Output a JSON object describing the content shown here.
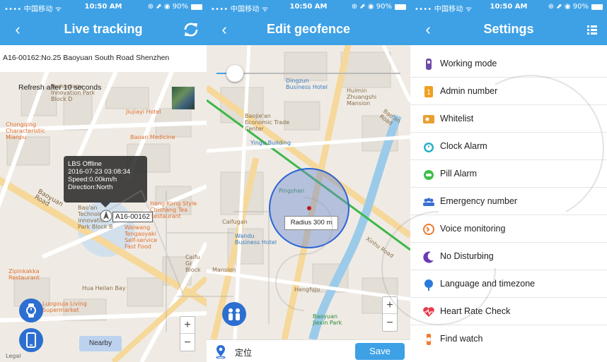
{
  "status_bar": {
    "carrier": "•••• 中国移动 ᯤ",
    "time": "10:50 AM",
    "battery": "⊕ ⬈ ◉ 90%"
  },
  "live_tracking": {
    "title": "Live tracking",
    "back": "‹",
    "address": "A16-00162:No.25 Baoyuan South Road Shenzhen",
    "refresh": "Refresh after 10 seconds",
    "info": {
      "status": "LBS Offline",
      "datetime": "2016-07-23 03:08:34",
      "speed": "Speed:0.00km/h",
      "direction": "Direction:North"
    },
    "device_tag": "A16-00162",
    "nearby": "Nearby",
    "zoom_in": "+",
    "zoom_out": "−",
    "legal": "Legal",
    "map_labels": {
      "technology_park": "Technology Innovation Park Block D",
      "jiujiayi": "Jiujiayi Hotel",
      "chongqing": "Chongqing Characteristic Mianpu",
      "baoan_medicine": "Baoan Medicine",
      "baoyuan_road": "Baoyuan Road",
      "baoan_tech": "Bao'an Technology Innovation Park Block B",
      "hong_kong": "Hong Kong Style Chishang Tea Restaurant",
      "weiwang": "Weiwang Tengaoyaki Self-service Fast Food",
      "zipinkakka": "Zipinkakka Restaurant",
      "hua_heilan": "Hua Heilan Bay",
      "luogouja": "Luogouja Living Supermarket",
      "caifu": "Caifu Gr Block"
    }
  },
  "edit_geofence": {
    "title": "Edit geofence",
    "back": "‹",
    "radius_label": "Radius 300 m",
    "location_label": "定位",
    "save": "Save",
    "zoom_in": "+",
    "zoom_out": "−",
    "map_labels": {
      "dingzun": "Dingzun Business Hotel",
      "huimin": "Huimin Zhuangshi Mansion",
      "baojiean": "Baojie'an Economic Trade Center",
      "yingu": "Yingu Building",
      "pingshan": "Pingshan",
      "caifugan": "Caifugan",
      "wandu": "Wandu Business Hotel",
      "mansion": "Mansion",
      "hengfuju": "Hengfuju",
      "baoyuan_jiexin": "Baoyuan Jiexin Park",
      "xinhu_road": "Xinhu Road",
      "baoan_road": "Bao'an Road"
    }
  },
  "settings": {
    "title": "Settings",
    "back": "‹",
    "items": [
      {
        "label": "Working mode",
        "icon": "watch-mode-icon",
        "color": "#6d4aa8"
      },
      {
        "label": "Admin number",
        "icon": "admin-number-icon",
        "color": "#f0a020"
      },
      {
        "label": "Whitelist",
        "icon": "whitelist-icon",
        "color": "#e8a030"
      },
      {
        "label": "Clock Alarm",
        "icon": "alarm-clock-icon",
        "color": "#2bb0c8"
      },
      {
        "label": "Pill Alarm",
        "icon": "pill-alarm-icon",
        "color": "#3bbf4a"
      },
      {
        "label": "Emergency number",
        "icon": "emergency-contacts-icon",
        "color": "#3a6fd0"
      },
      {
        "label": "Voice monitoring",
        "icon": "voice-monitoring-icon",
        "color": "#f07a30"
      },
      {
        "label": "No Disturbing",
        "icon": "moon-icon",
        "color": "#6a3ab8"
      },
      {
        "label": "Language and timezone",
        "icon": "language-globe-icon",
        "color": "#2a7ad8"
      },
      {
        "label": "Heart Rate Check",
        "icon": "heart-icon",
        "color": "#e83a4a"
      },
      {
        "label": "Find watch",
        "icon": "find-watch-icon",
        "color": "#f07a30"
      }
    ]
  }
}
